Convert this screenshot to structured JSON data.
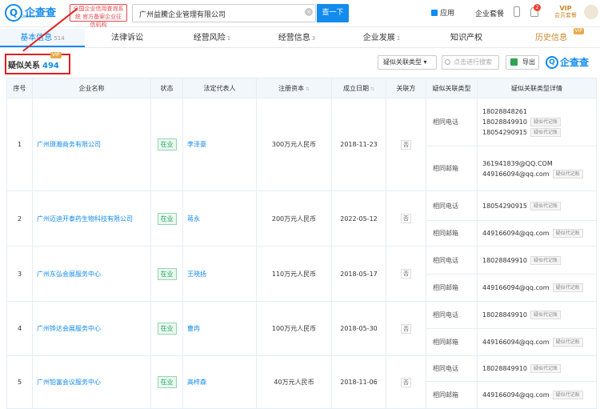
{
  "header": {
    "logo_text": "企查查",
    "logo_sub": "Qcc.com",
    "slogan": "全国企业信用查询系统 官方备案企业征信机构",
    "search_value": "广州益騰企业管理有限公司",
    "search_button": "查一下",
    "apps_label": "应用",
    "ent_label": "企业套餐",
    "notif_count": "2",
    "vip_label": "VIP",
    "vip_sub": "会员套餐"
  },
  "tabs": [
    {
      "label": "基本信息",
      "count": "514",
      "active": true
    },
    {
      "label": "法律诉讼",
      "count": "",
      "active": false
    },
    {
      "label": "经营风险",
      "count": "1",
      "active": false
    },
    {
      "label": "经营信息",
      "count": "3",
      "active": false
    },
    {
      "label": "企业发展",
      "count": "1",
      "active": false
    },
    {
      "label": "知识产权",
      "count": "",
      "active": false
    },
    {
      "label": "历史信息",
      "count": "",
      "active": false,
      "vip": "VIP"
    }
  ],
  "section": {
    "title": "疑似关系",
    "count": "494",
    "vip_tag": "VIP",
    "filter_label": "疑似关联类型",
    "search_placeholder": "点击进行搜索",
    "export_label": "导出",
    "brand": "企查查"
  },
  "table": {
    "headers": [
      "序号",
      "企业名称",
      "状态",
      "法定代表人",
      "注册资本",
      "成立日期",
      "关联方",
      "疑似关联类型",
      "疑似关联类型详情"
    ],
    "rows": [
      {
        "no": "1",
        "company": "广州璟瀚商务有限公司",
        "status": "在业",
        "legal": "李泽豪",
        "capital": "300万元人民币",
        "date": "2018-11-23",
        "rel": "否",
        "types": [
          "相同电话",
          "相同邮箱"
        ],
        "details": [
          [
            {
              "text": "18028848261",
              "tag": ""
            },
            {
              "text": "18028849910",
              "tag": "疑似代记账"
            },
            {
              "text": "18054290915",
              "tag": "疑似代记账"
            }
          ],
          [
            {
              "text": "361941839@QQ.COM",
              "tag": ""
            },
            {
              "text": "449166094@qq.com",
              "tag": "疑似代记账"
            }
          ]
        ]
      },
      {
        "no": "2",
        "company": "广州迈迪开泰药生物科技有限公司",
        "status": "在业",
        "legal": "蒋永",
        "capital": "200万元人民币",
        "date": "2022-05-12",
        "rel": "否",
        "types": [
          "相同电话",
          "相同邮箱"
        ],
        "details": [
          [
            {
              "text": "18054290915",
              "tag": "疑似代记账"
            }
          ],
          [
            {
              "text": "449166094@qq.com",
              "tag": "疑似代记账"
            }
          ]
        ]
      },
      {
        "no": "3",
        "company": "广州东弘会展服务中心",
        "status": "在业",
        "legal": "王晓扬",
        "capital": "110万元人民币",
        "date": "2018-05-17",
        "rel": "否",
        "types": [
          "相同电话",
          "相同邮箱"
        ],
        "details": [
          [
            {
              "text": "18028849910",
              "tag": "疑似代记账"
            }
          ],
          [
            {
              "text": "449166094@qq.com",
              "tag": "疑似代记账"
            }
          ]
        ]
      },
      {
        "no": "4",
        "company": "广州铧达会展服务中心",
        "status": "在业",
        "legal": "曹冉",
        "capital": "100万元人民币",
        "date": "2018-05-30",
        "rel": "否",
        "types": [
          "相同电话",
          "相同邮箱"
        ],
        "details": [
          [
            {
              "text": "18028849910",
              "tag": "疑似代记账"
            }
          ],
          [
            {
              "text": "449166094@qq.com",
              "tag": "疑似代记账"
            }
          ]
        ]
      },
      {
        "no": "5",
        "company": "广州铂富会议服务中心",
        "status": "在业",
        "legal": "高梓森",
        "capital": "40万元人民币",
        "date": "2018-11-06",
        "rel": "否",
        "types": [
          "相同电话",
          "相同邮箱"
        ],
        "details": [
          [
            {
              "text": "18028849910",
              "tag": "疑似代记账"
            }
          ],
          [
            {
              "text": "449166094@qq.com",
              "tag": "疑似代记账"
            }
          ]
        ]
      }
    ]
  },
  "colors": {
    "accent": "#128bed",
    "annotation": "#e02020",
    "status_green": "#2aab61"
  }
}
